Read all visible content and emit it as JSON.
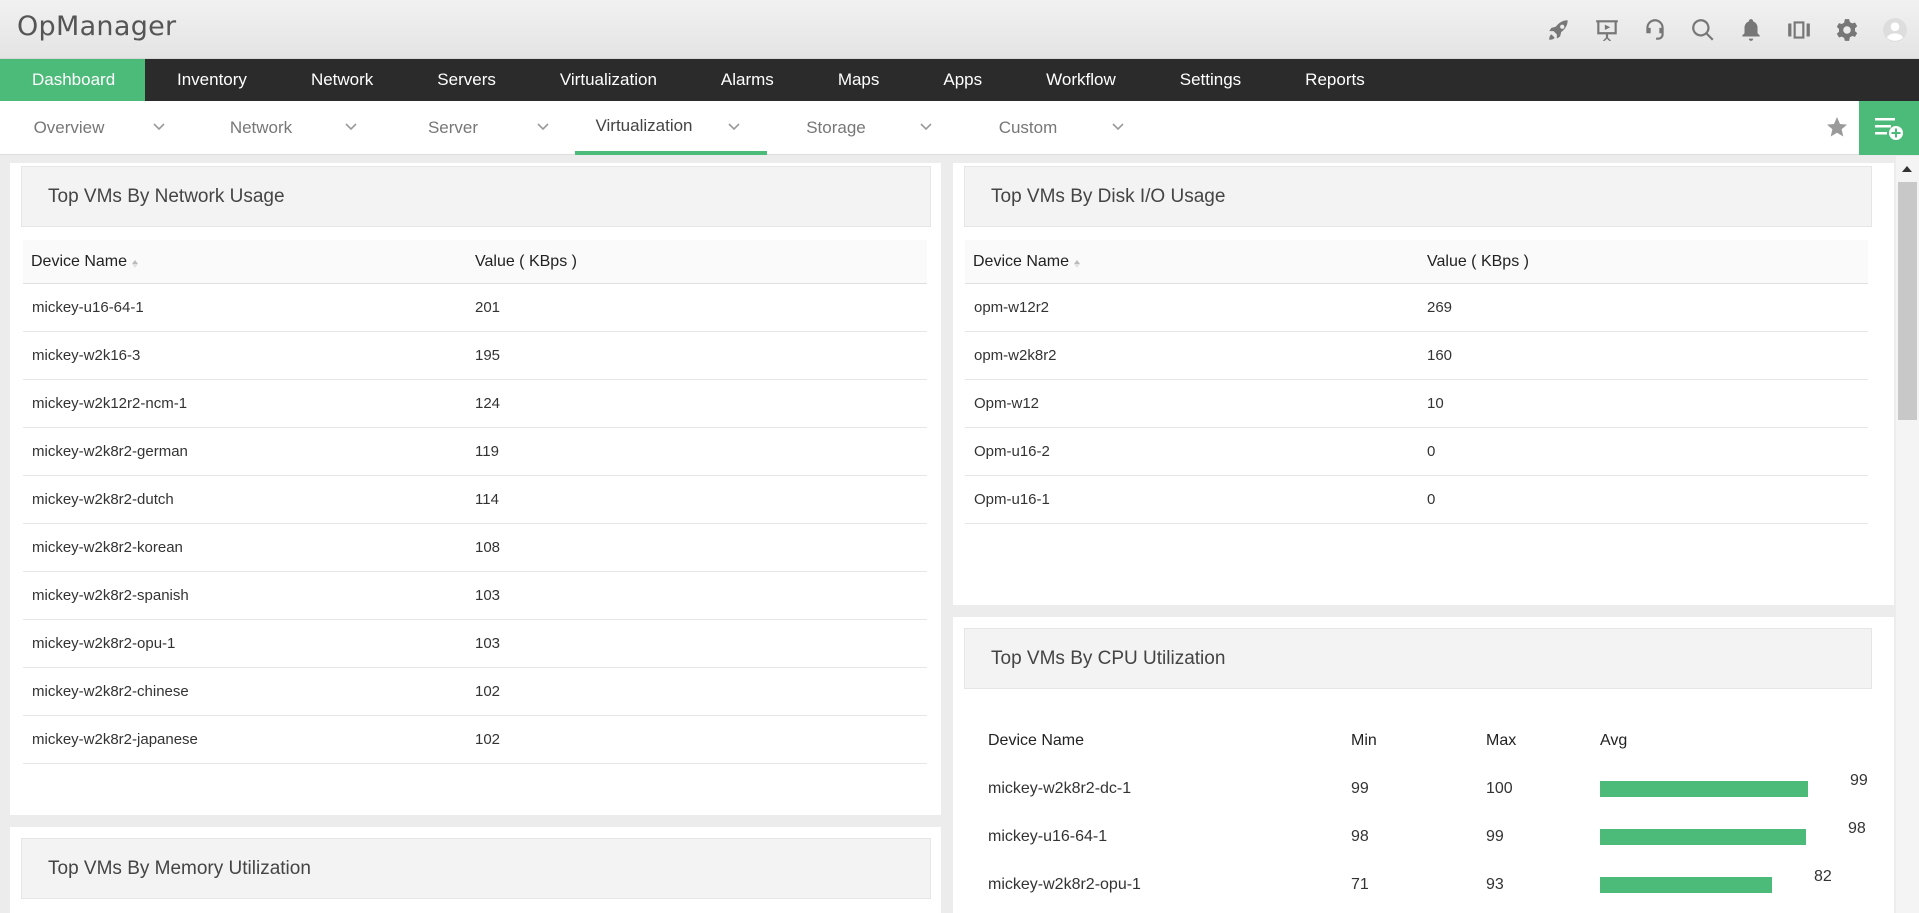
{
  "app": {
    "title": "OpManager"
  },
  "top_icons": [
    "rocket-icon",
    "presentation-icon",
    "support-headset-icon",
    "search-icon",
    "bell-icon",
    "film-icon",
    "gear-icon",
    "user-avatar-icon"
  ],
  "main_menu": {
    "items": [
      {
        "label": "Dashboard",
        "active": true
      },
      {
        "label": "Inventory"
      },
      {
        "label": "Network"
      },
      {
        "label": "Servers"
      },
      {
        "label": "Virtualization"
      },
      {
        "label": "Alarms"
      },
      {
        "label": "Maps"
      },
      {
        "label": "Apps"
      },
      {
        "label": "Workflow"
      },
      {
        "label": "Settings"
      },
      {
        "label": "Reports"
      }
    ]
  },
  "sub_menu": {
    "tabs": [
      {
        "label": "Overview"
      },
      {
        "label": "Network"
      },
      {
        "label": "Server"
      },
      {
        "label": "Virtualization",
        "active": true
      },
      {
        "label": "Storage"
      },
      {
        "label": "Custom"
      }
    ]
  },
  "colors": {
    "accent": "#4cbb7a",
    "menu_bg": "#2b2b2b"
  },
  "network_widget": {
    "title": "Top VMs By Network Usage",
    "col_device": "Device Name",
    "col_value": "Value ( KBps )",
    "rows": [
      {
        "device": "mickey-u16-64-1",
        "value": "201"
      },
      {
        "device": "mickey-w2k16-3",
        "value": "195"
      },
      {
        "device": "mickey-w2k12r2-ncm-1",
        "value": "124"
      },
      {
        "device": "mickey-w2k8r2-german",
        "value": "119"
      },
      {
        "device": "mickey-w2k8r2-dutch",
        "value": "114"
      },
      {
        "device": "mickey-w2k8r2-korean",
        "value": "108"
      },
      {
        "device": "mickey-w2k8r2-spanish",
        "value": "103"
      },
      {
        "device": "mickey-w2k8r2-opu-1",
        "value": "103"
      },
      {
        "device": "mickey-w2k8r2-chinese",
        "value": "102"
      },
      {
        "device": "mickey-w2k8r2-japanese",
        "value": "102"
      }
    ]
  },
  "disk_widget": {
    "title": "Top VMs By Disk I/O Usage",
    "col_device": "Device Name",
    "col_value": "Value ( KBps )",
    "rows": [
      {
        "device": "opm-w12r2",
        "value": "269"
      },
      {
        "device": "opm-w2k8r2",
        "value": "160"
      },
      {
        "device": "Opm-w12",
        "value": "10"
      },
      {
        "device": "Opm-u16-2",
        "value": "0"
      },
      {
        "device": "Opm-u16-1",
        "value": "0"
      }
    ]
  },
  "memory_widget": {
    "title": "Top VMs By Memory Utilization"
  },
  "cpu_widget": {
    "title": "Top VMs By CPU Utilization",
    "col_device": "Device Name",
    "col_min": "Min",
    "col_max": "Max",
    "col_avg": "Avg",
    "rows": [
      {
        "device": "mickey-w2k8r2-dc-1",
        "min": "99",
        "max": "100",
        "avg": "99",
        "avg_pct": 99
      },
      {
        "device": "mickey-u16-64-1",
        "min": "98",
        "max": "99",
        "avg": "98",
        "avg_pct": 98
      },
      {
        "device": "mickey-w2k8r2-opu-1",
        "min": "71",
        "max": "93",
        "avg": "82",
        "avg_pct": 82
      }
    ]
  }
}
